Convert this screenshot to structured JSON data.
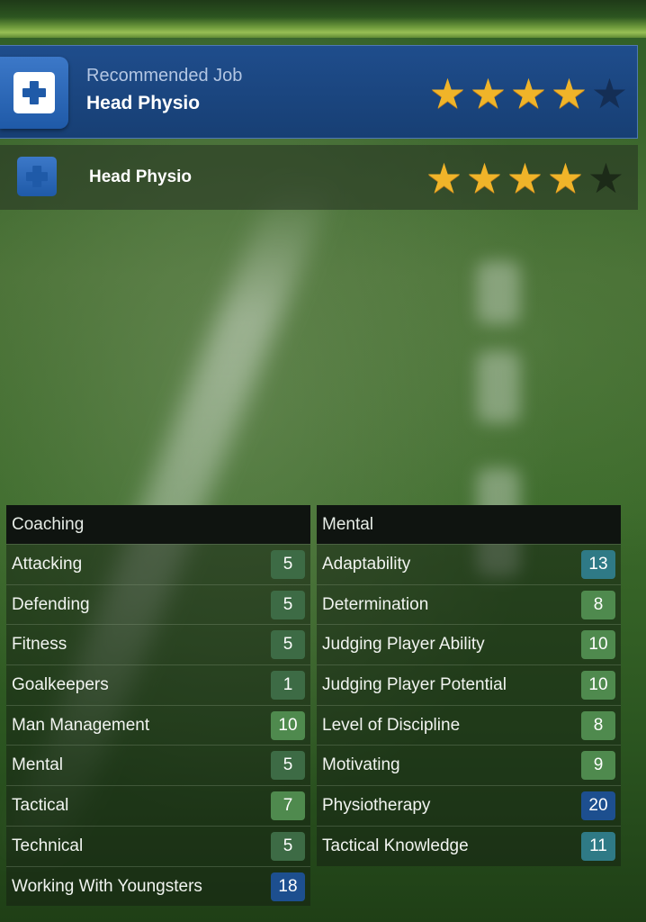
{
  "recommended": {
    "subtitle": "Recommended Job",
    "title": "Head Physio",
    "rating": 4,
    "max_rating": 5
  },
  "role": {
    "title": "Head Physio",
    "rating": 4,
    "max_rating": 5
  },
  "coaching": {
    "header": "Coaching",
    "items": [
      {
        "label": "Attacking",
        "value": "5",
        "tier": "green"
      },
      {
        "label": "Defending",
        "value": "5",
        "tier": "green"
      },
      {
        "label": "Fitness",
        "value": "5",
        "tier": "green"
      },
      {
        "label": "Goalkeepers",
        "value": "1",
        "tier": "green"
      },
      {
        "label": "Man Management",
        "value": "10",
        "tier": "green-bright"
      },
      {
        "label": "Mental",
        "value": "5",
        "tier": "green"
      },
      {
        "label": "Tactical",
        "value": "7",
        "tier": "green-bright"
      },
      {
        "label": "Technical",
        "value": "5",
        "tier": "green"
      },
      {
        "label": "Working With Youngsters",
        "value": "18",
        "tier": "blue"
      }
    ]
  },
  "mental": {
    "header": "Mental",
    "items": [
      {
        "label": "Adaptability",
        "value": "13",
        "tier": "teal"
      },
      {
        "label": "Determination",
        "value": "8",
        "tier": "green-bright"
      },
      {
        "label": "Judging Player Ability",
        "value": "10",
        "tier": "green-bright"
      },
      {
        "label": "Judging Player Potential",
        "value": "10",
        "tier": "green-bright"
      },
      {
        "label": "Level of Discipline",
        "value": "8",
        "tier": "green-bright"
      },
      {
        "label": "Motivating",
        "value": "9",
        "tier": "green-bright"
      },
      {
        "label": "Physiotherapy",
        "value": "20",
        "tier": "blue"
      },
      {
        "label": "Tactical Knowledge",
        "value": "11",
        "tier": "teal"
      }
    ]
  },
  "colors": {
    "star_on": "#f0b429",
    "header_blue": "#1f4d8c",
    "badge_green": "#3d6b45",
    "badge_teal": "#2f7a86",
    "badge_blue": "#1d4f8f"
  }
}
